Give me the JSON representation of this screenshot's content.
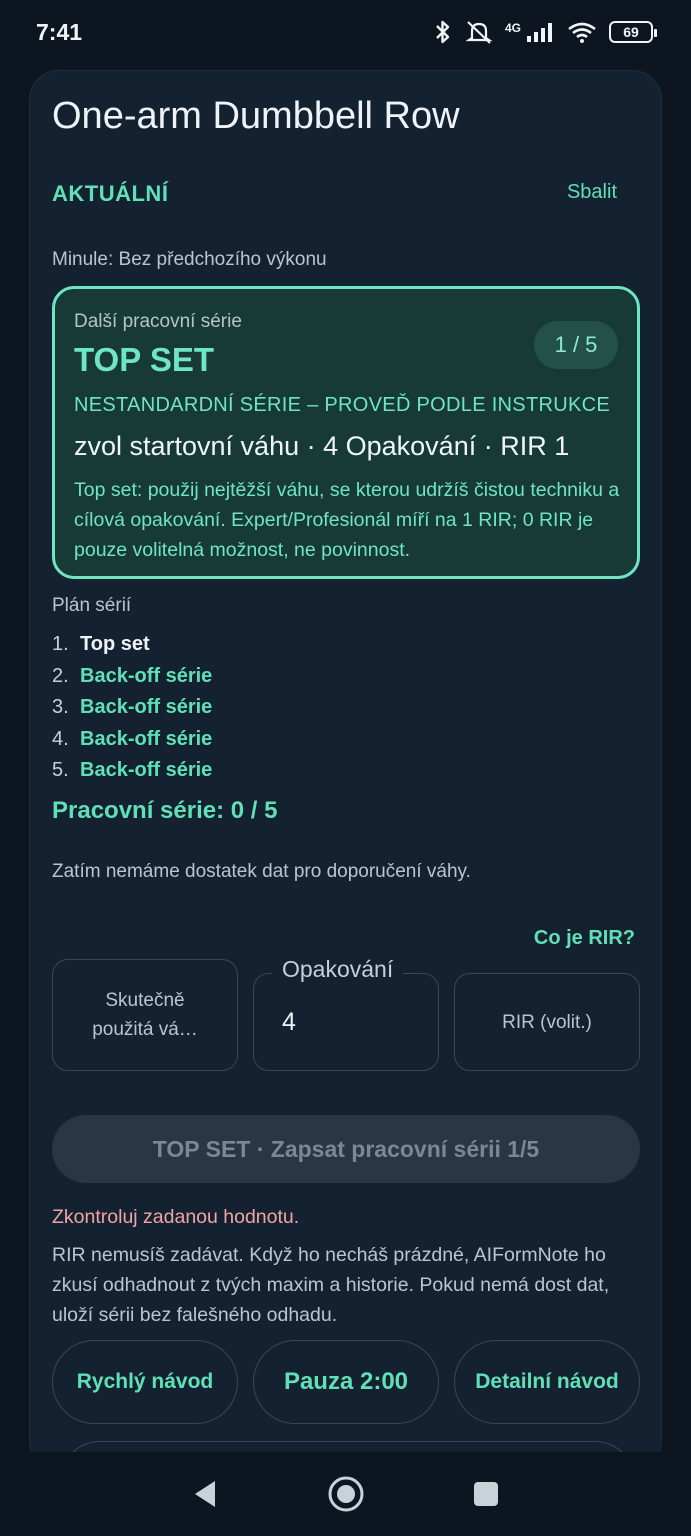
{
  "status": {
    "time": "7:41",
    "network": "4G",
    "battery": "69"
  },
  "exercise": {
    "title": "One-arm Dumbbell Row"
  },
  "header": {
    "section": "AKTUÁLNÍ",
    "collapse": "Sbalit"
  },
  "last": "Minule: Bez předchozího výkonu",
  "next_set": {
    "label": "Další pracovní série",
    "title": "TOP SET",
    "counter": "1 / 5",
    "type": "NESTANDARDNÍ SÉRIE – PROVEĎ PODLE INSTRUKCE",
    "target": "zvol startovní váhu · 4 Opakování · RIR 1",
    "description": "Top set: použij nejtěžší váhu, se kterou udržíš čistou techniku a cílová opakování. Expert/Profesionál míří na 1 RIR; 0 RIR je pouze volitelná možnost, ne povinnost."
  },
  "plan": {
    "label": "Plán sérií",
    "items": [
      {
        "num": "1.",
        "name": "Top set"
      },
      {
        "num": "2.",
        "name": "Back-off série"
      },
      {
        "num": "3.",
        "name": "Back-off série"
      },
      {
        "num": "4.",
        "name": "Back-off série"
      },
      {
        "num": "5.",
        "name": "Back-off série"
      }
    ]
  },
  "work_count": "Pracovní série: 0 / 5",
  "no_data": "Zatím nemáme dostatek dat pro doporučení váhy.",
  "rir_help": "Co je RIR?",
  "inputs": {
    "weight_placeholder": "Skutečně použitá vá…",
    "reps_label": "Opakování",
    "reps_value": "4",
    "rir_placeholder": "RIR (volit.)"
  },
  "log_button": "TOP SET · Zapsat pracovní sérii 1/5",
  "error": "Zkontroluj zadanou hodnotu.",
  "rir_note": "RIR nemusíš zadávat. Když ho necháš prázdné, AIFormNote ho zkusí odhadnout z tvých maxim a historie. Pokud nemá dost dat, uloží sérii bez falešného odhadu.",
  "chips": {
    "quick_guide": "Rychlý návod",
    "pause": "Pauza 2:00",
    "detail_guide": "Detailní návod"
  },
  "colors": {
    "accent": "#5fe0b7",
    "background": "#0d1520",
    "card": "#142130",
    "error": "#f0a5a5"
  }
}
